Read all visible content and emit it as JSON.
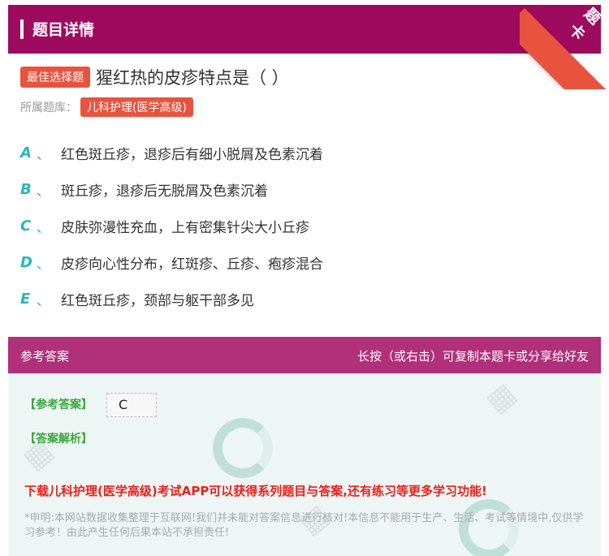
{
  "header": {
    "title": "题目详情",
    "ribbon": "题卡"
  },
  "question": {
    "type_badge": "最佳选择题",
    "text": "猩红热的皮疹特点是（ ）",
    "category_label": "所属题库：",
    "category": "儿科护理(医学高级)"
  },
  "options": [
    {
      "letter": "A",
      "sep": "、",
      "text": "红色斑丘疹，退疹后有细小脱屑及色素沉着"
    },
    {
      "letter": "B",
      "sep": "、",
      "text": "斑丘疹，退疹后无脱屑及色素沉着"
    },
    {
      "letter": "C",
      "sep": "、",
      "text": "皮肤弥漫性充血，上有密集针尖大小丘疹"
    },
    {
      "letter": "D",
      "sep": "、",
      "text": "皮疹向心性分布，红斑疹、丘疹、疱疹混合"
    },
    {
      "letter": "E",
      "sep": "、",
      "text": "红色斑丘疹，颈部与躯干部多见"
    }
  ],
  "answer": {
    "section_title": "参考答案",
    "share_hint": "长按（或右击）可复制本题卡或分享给好友",
    "answer_label": "【参考答案】",
    "answer_value": "C",
    "analysis_label": "【答案解析】",
    "promo": "下载儿科护理(医学高级)考试APP可以获得系列题目与答案,还有练习等更多学习功能!",
    "disclaimer": "*申明:本网站数据收集整理于互联网!我们并未能对答案信息进行核对!本信息不能用于生产、生活、考试等情境中,仅供学习参考！由此产生任何后果本站不承担责任!"
  },
  "colors": {
    "header": "#9e0b5e",
    "answer_header": "#b0307a",
    "badge": "#e8533f",
    "option_letter": "#2bb6b6",
    "answer_label": "#3ca73c",
    "promo": "#e8201a"
  }
}
